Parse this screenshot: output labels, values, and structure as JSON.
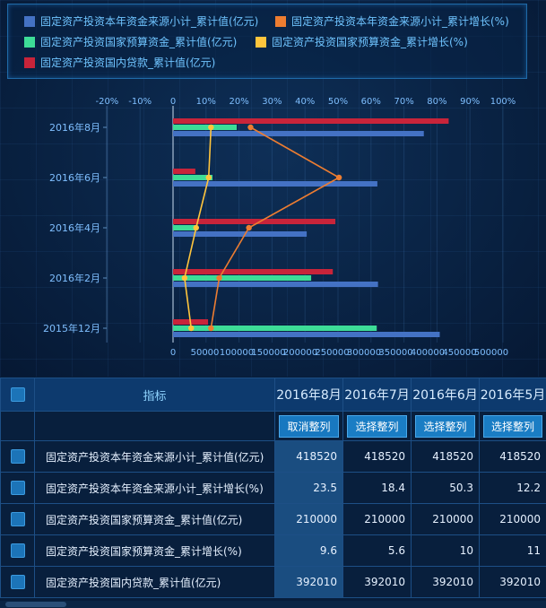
{
  "legend": [
    {
      "label": "固定资产投资本年资金来源小计_累计值(亿元)",
      "color": "#4472c4"
    },
    {
      "label": "固定资产投资本年资金来源小计_累计增长(%)",
      "color": "#ed7d31"
    },
    {
      "label": "固定资产投资国家预算资金_累计值(亿元)",
      "color": "#3ddc97"
    },
    {
      "label": "固定资产投资国家预算资金_累计增长(%)",
      "color": "#ffc53d"
    },
    {
      "label": "固定资产投资国内贷款_累计值(亿元)",
      "color": "#c8243a"
    }
  ],
  "chart_data": {
    "type": "bar",
    "orientation": "horizontal",
    "categories": [
      "2016年8月",
      "2016年6月",
      "2016年4月",
      "2016年2月",
      "2015年12月"
    ],
    "value_axis": {
      "ticks": [
        "0",
        "50000",
        "100000",
        "150000",
        "200000",
        "250000",
        "300000",
        "350000",
        "400000",
        "450000",
        "500000"
      ],
      "range": [
        0,
        500000
      ]
    },
    "pct_axis": {
      "ticks": [
        "-20%",
        "-10%",
        "0",
        "10%",
        "20%",
        "30%",
        "40%",
        "50%",
        "60%",
        "70%",
        "80%",
        "90%",
        "100%"
      ],
      "range": [
        0,
        100
      ]
    },
    "series": [
      {
        "name": "固定资产投资本年资金来源小计_累计值(亿元)",
        "kind": "bar",
        "axis": "value",
        "color": "#4472c4",
        "values": [
          394000,
          321000,
          210000,
          322000,
          419000
        ]
      },
      {
        "name": "固定资产投资国家预算资金_累计值(亿元)",
        "kind": "bar",
        "axis": "value",
        "color": "#3ddc97",
        "values": [
          100000,
          62000,
          36000,
          217000,
          320000
        ]
      },
      {
        "name": "固定资产投资国内贷款_累计值(亿元)",
        "kind": "bar",
        "axis": "value",
        "color": "#c8243a",
        "values": [
          433000,
          35000,
          255000,
          251000,
          55000
        ]
      },
      {
        "name": "固定资产投资本年资金来源小计_累计增长(%)",
        "kind": "line",
        "axis": "pct",
        "color": "#ed7d31",
        "values": [
          23.5,
          50.3,
          23.0,
          14.0,
          11.5
        ]
      },
      {
        "name": "固定资产投资国家预算资金_累计增长(%)",
        "kind": "line",
        "axis": "pct",
        "color": "#ffc53d",
        "values": [
          11.5,
          10.8,
          7.0,
          3.5,
          5.5
        ]
      }
    ]
  },
  "table": {
    "header_label": "指标",
    "months": [
      "2016年8月",
      "2016年7月",
      "2016年6月",
      "2016年5月"
    ],
    "buttons": [
      "取消整列",
      "选择整列",
      "选择整列",
      "选择整列"
    ],
    "rows": [
      {
        "name": "固定资产投资本年资金来源小计_累计值(亿元)",
        "values": [
          "418520",
          "418520",
          "418520",
          "418520"
        ]
      },
      {
        "name": "固定资产投资本年资金来源小计_累计增长(%)",
        "values": [
          "23.5",
          "18.4",
          "50.3",
          "12.2"
        ]
      },
      {
        "name": "固定资产投资国家预算资金_累计值(亿元)",
        "values": [
          "210000",
          "210000",
          "210000",
          "210000"
        ]
      },
      {
        "name": "固定资产投资国家预算资金_累计增长(%)",
        "values": [
          "9.6",
          "5.6",
          "10",
          "11"
        ]
      },
      {
        "name": "固定资产投资国内贷款_累计值(亿元)",
        "values": [
          "392010",
          "392010",
          "392010",
          "392010"
        ]
      }
    ]
  }
}
